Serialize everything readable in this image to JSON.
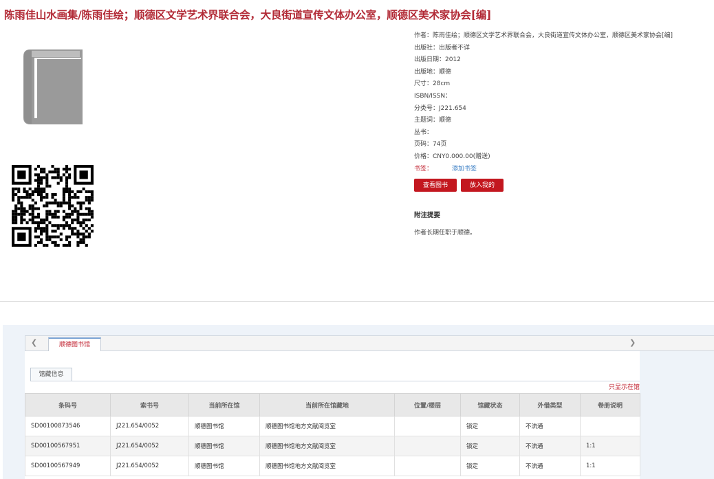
{
  "title": "陈雨佳山水画集/陈雨佳绘；顺德区文学艺术界联合会，大良街道宣传文体办公室，顺德区美术家协会[编]",
  "colors": {
    "title": "#b22a36",
    "button": "#c3171f",
    "link": "#2d76c1"
  },
  "icons": {
    "cover": "book-icon",
    "qr": "qr-code-icon"
  },
  "meta": {
    "author": "作者：陈雨佳绘；顺德区文学艺术界联合会，大良街道宣传文体办公室，顺德区美术家协会[编]",
    "publisher": "出版社：出版者不详",
    "date": "出版日期：2012",
    "place": "出版地：顺德",
    "size": "尺寸：28cm",
    "isbn": "ISBN/ISSN：",
    "classno": "分类号：J221.654",
    "subject": "主题词：顺德",
    "series": "丛书：",
    "pages": "页码：74页",
    "price": "价格：CNY0.000.00(赠送)",
    "bookmark_label": "书签：",
    "bookmark_link": "添加书签"
  },
  "buttons": {
    "review": "查看图书评论",
    "shelf": "放入我的书架"
  },
  "notes": {
    "heading": "附注提要",
    "text": "作者长期任职于顺德。"
  },
  "holdings": {
    "tab": "顺德图书馆",
    "subtab": "馆藏信息",
    "only_available": "只显示在馆",
    "columns": [
      "条码号",
      "索书号",
      "当前所在馆",
      "当前所在馆藏地",
      "位置/楼层",
      "馆藏状态",
      "外借类型",
      "卷册说明"
    ],
    "rows": [
      [
        "SD00100873546",
        "J221.654/0052",
        "顺德图书馆",
        "顺德图书馆地方文献阅览室",
        "",
        "锁定",
        "不流通",
        ""
      ],
      [
        "SD00100567951",
        "J221.654/0052",
        "顺德图书馆",
        "顺德图书馆地方文献阅览室",
        "",
        "锁定",
        "不流通",
        "1:1"
      ],
      [
        "SD00100567949",
        "J221.654/0052",
        "顺德图书馆",
        "顺德图书馆地方文献阅览室",
        "",
        "锁定",
        "不流通",
        "1:1"
      ]
    ]
  }
}
